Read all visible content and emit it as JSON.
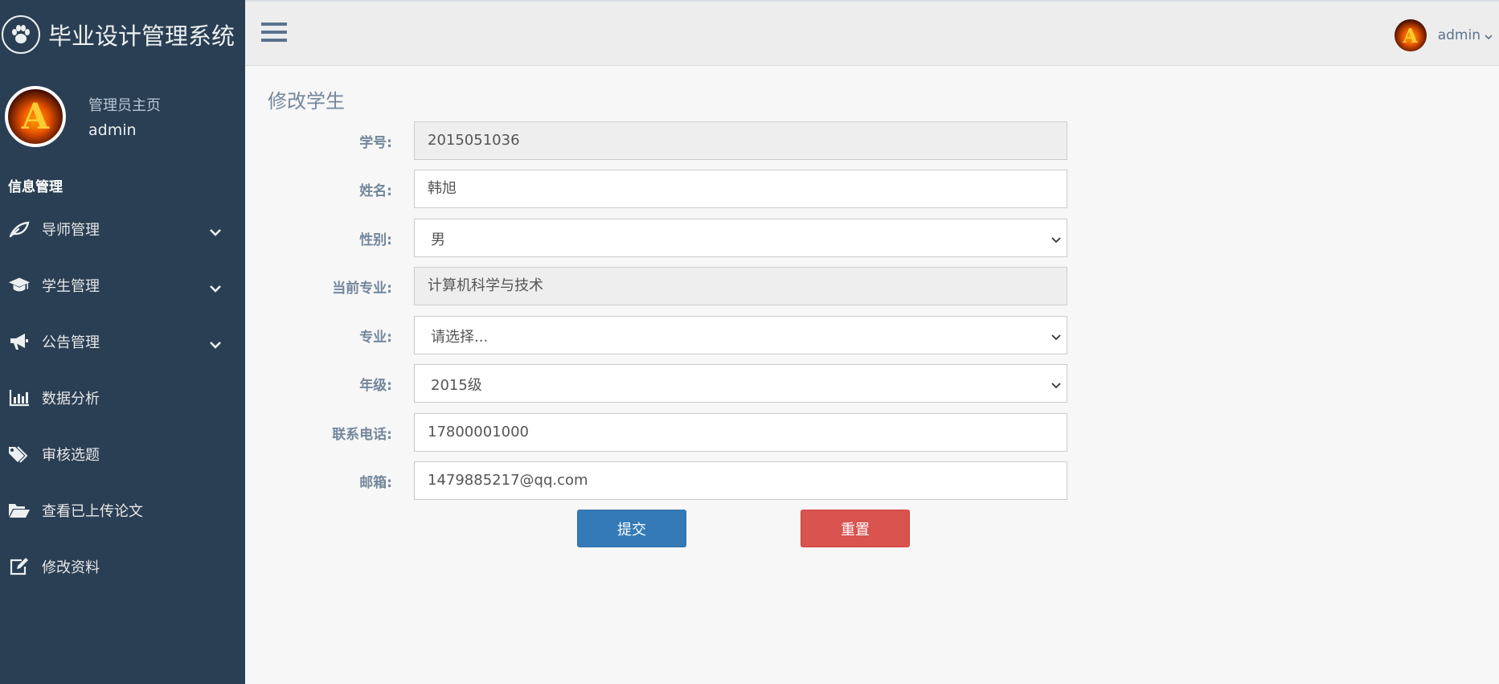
{
  "app": {
    "title": "毕业设计管理系统"
  },
  "profile": {
    "welcome": "管理员主页",
    "name": "admin",
    "avatar_letter": "A"
  },
  "sidebar": {
    "section_title": "信息管理",
    "items": [
      {
        "label": "导师管理",
        "icon": "leaf-icon",
        "has_submenu": true
      },
      {
        "label": "学生管理",
        "icon": "graduation-cap-icon",
        "has_submenu": true
      },
      {
        "label": "公告管理",
        "icon": "bullhorn-icon",
        "has_submenu": true
      },
      {
        "label": "数据分析",
        "icon": "bar-chart-icon",
        "has_submenu": false
      },
      {
        "label": "审核选题",
        "icon": "tags-icon",
        "has_submenu": false
      },
      {
        "label": "查看已上传论文",
        "icon": "folder-open-icon",
        "has_submenu": false
      },
      {
        "label": "修改资料",
        "icon": "edit-icon",
        "has_submenu": false
      }
    ]
  },
  "topbar": {
    "user_name": "admin",
    "avatar_letter": "A"
  },
  "form": {
    "title": "修改学生",
    "fields": {
      "student_id": {
        "label": "学号:",
        "value": "2015051036"
      },
      "name": {
        "label": "姓名:",
        "value": "韩旭"
      },
      "gender": {
        "label": "性别:",
        "value": "男"
      },
      "current_major": {
        "label": "当前专业:",
        "value": "计算机科学与技术"
      },
      "major": {
        "label": "专业:",
        "value": "请选择..."
      },
      "grade": {
        "label": "年级:",
        "value": "2015级"
      },
      "phone": {
        "label": "联系电话:",
        "value": "17800001000"
      },
      "email": {
        "label": "邮箱:",
        "value": "1479885217@qq.com"
      }
    },
    "submit_label": "提交",
    "reset_label": "重置"
  },
  "colors": {
    "sidebar_bg": "#2a3f54",
    "primary": "#337ab7",
    "danger": "#d9534f"
  }
}
